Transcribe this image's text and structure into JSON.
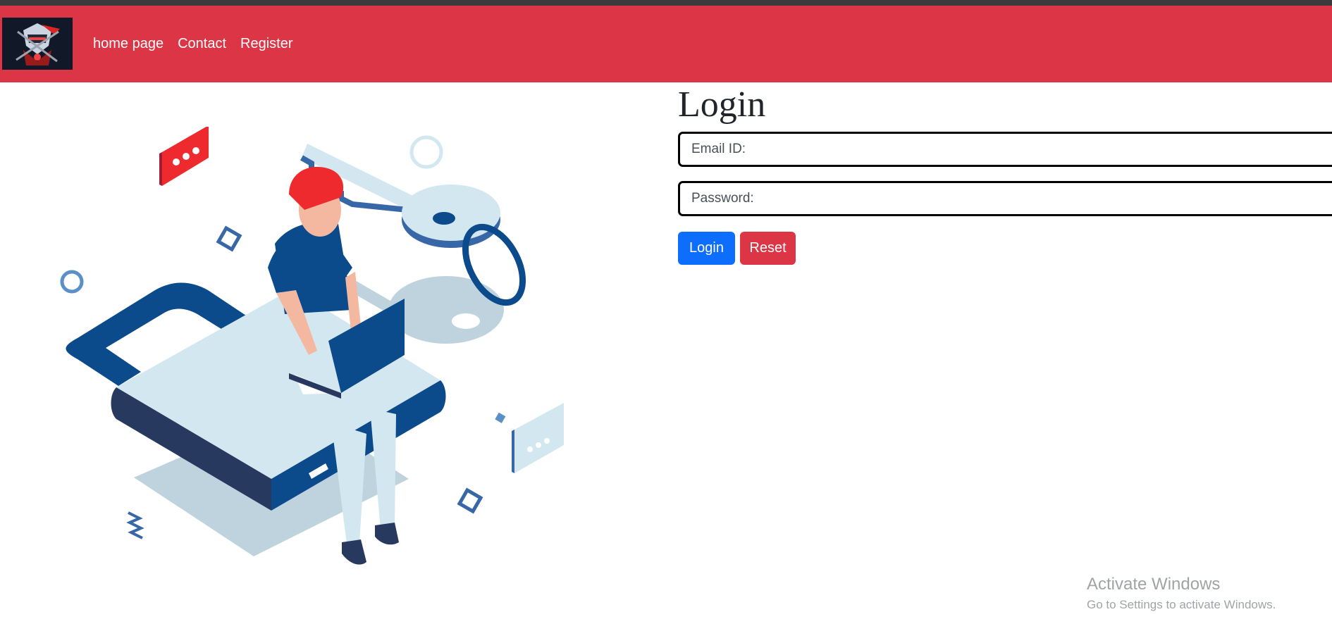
{
  "navbar": {
    "logo_alt": "Site logo",
    "links": [
      {
        "label": "home page"
      },
      {
        "label": "Contact"
      },
      {
        "label": "Register"
      }
    ],
    "background": "#dc3545"
  },
  "illustration": {
    "description_icon": "person-with-laptop-sitting-on-padlock-with-key"
  },
  "login": {
    "title": "Login",
    "email_placeholder": "Email ID:",
    "email_value": "",
    "password_placeholder": "Password:",
    "password_value": "",
    "login_button": "Login",
    "reset_button": "Reset",
    "login_color": "#0d6efd",
    "reset_color": "#dc3545"
  },
  "watermark": {
    "title": "Activate Windows",
    "subtitle": "Go to Settings to activate Windows."
  }
}
